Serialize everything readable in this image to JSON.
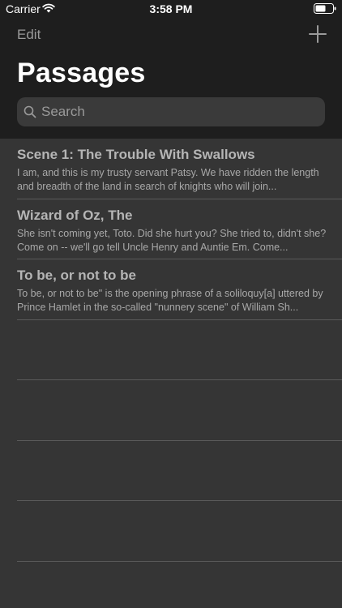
{
  "status_bar": {
    "carrier": "Carrier",
    "time": "3:58 PM"
  },
  "nav": {
    "edit_label": "Edit",
    "title": "Passages"
  },
  "search": {
    "placeholder": "Search"
  },
  "passages": [
    {
      "title": "Scene 1: The Trouble With Swallows",
      "body": "I am, and this is my trusty servant Patsy. We have ridden the length and breadth of the land in search of knights who will join..."
    },
    {
      "title": "Wizard of Oz, The",
      "body": "She isn't coming yet, Toto. Did she hurt you?  She tried to, didn't she?  Come on -- we'll go tell Uncle Henry and Auntie Em. Come..."
    },
    {
      "title": "To be, or not to be",
      "body": "To be, or not to be\" is the opening phrase of a soliloquy[a] uttered by Prince Hamlet in the so-called \"nunnery scene\" of William Sh..."
    }
  ],
  "colors": {
    "header_bg": "#1e1e1e",
    "list_bg": "#353535",
    "separator": "#5a5a5a",
    "title_text": "#b5b5b5"
  },
  "icons": {
    "wifi": "wifi-icon",
    "battery": "battery-icon",
    "add": "plus-icon",
    "search": "search-icon"
  }
}
